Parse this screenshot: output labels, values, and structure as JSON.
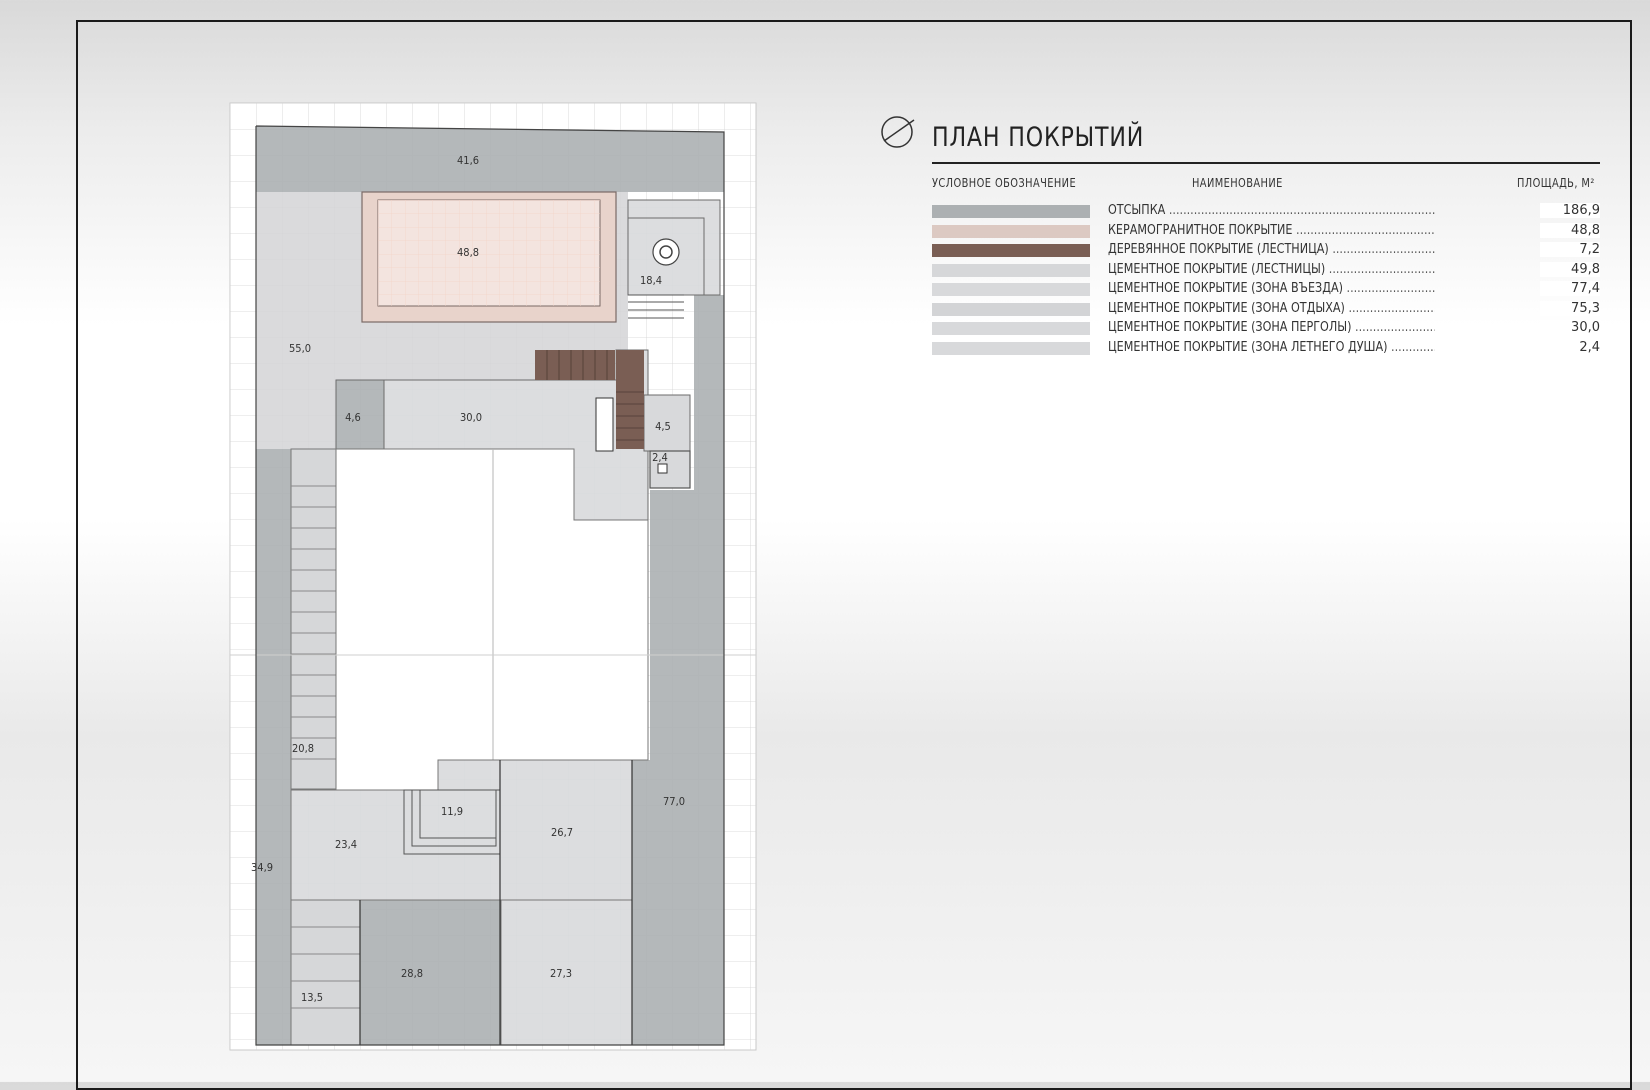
{
  "legend": {
    "title": "ПЛАН ПОКРЫТИЙ",
    "col_symbol": "УСЛОВНОЕ ОБОЗНАЧЕНИЕ",
    "col_name": "НАИМЕНОВАНИЕ",
    "col_area": "ПЛОЩАДЬ, М²",
    "items": [
      {
        "name": "ОТСЫПКА",
        "area": "186,9",
        "color": "#acb0b2"
      },
      {
        "name": "КЕРАМОГРАНИТНОЕ ПОКРЫТИЕ",
        "area": "48,8",
        "color": "#dcc9c2"
      },
      {
        "name": "ДЕРЕВЯННОЕ ПОКРЫТИЕ (ЛЕСТНИЦА)",
        "area": "7,2",
        "color": "#7a5e54"
      },
      {
        "name": "ЦЕМЕНТНОЕ ПОКРЫТИЕ (ЛЕСТНИЦЫ)",
        "area": "49,8",
        "color": "#d6d7d9"
      },
      {
        "name": "ЦЕМЕНТНОЕ ПОКРЫТИЕ (ЗОНА ВЪЕЗДА)",
        "area": "77,4",
        "color": "#d8d9db"
      },
      {
        "name": "ЦЕМЕНТНОЕ ПОКРЫТИЕ (ЗОНА ОТДЫХА)",
        "area": "75,3",
        "color": "#d3d4d6"
      },
      {
        "name": "ЦЕМЕНТНОЕ ПОКРЫТИЕ (ЗОНА ПЕРГОЛЫ)",
        "area": "30,0",
        "color": "#d8d9db"
      },
      {
        "name": "ЦЕМЕНТНОЕ ПОКРЫТИЕ (ЗОНА ЛЕТНЕГО ДУША)",
        "area": "2,4",
        "color": "#d8d9db"
      }
    ]
  },
  "plan": {
    "area_labels": [
      "41,6",
      "48,8",
      "18,4",
      "55,0",
      "4,6",
      "30,0",
      "4,5",
      "2,4",
      "20,8",
      "11,9",
      "77,0",
      "23,4",
      "26,7",
      "34,9",
      "28,8",
      "27,3",
      "13,5"
    ]
  }
}
